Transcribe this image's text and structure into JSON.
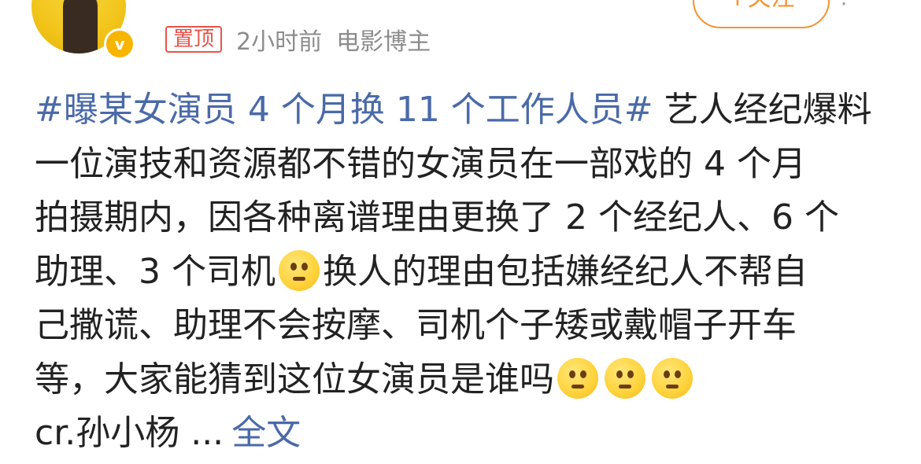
{
  "post": {
    "author_name": "",
    "follow_label": "+关注",
    "more_label": "⋮",
    "pin_label": "置顶",
    "time": "2小时前",
    "source": "电影博主",
    "topic": "#曝某女演员 4 个月换 11 个工作人员#",
    "text_lines": [
      " 艺人经纪爆料",
      "一位演技和资源都不错的女演员在一部戏的 4 个月",
      "拍摄期内，因各种离谱理由更换了 2 个经纪人、6 个",
      "助理、3 个司机",
      "换人的理由包括嫌经纪人不帮自",
      "己撒谎、助理不会按摩、司机个子矮或戴帽子开车",
      "等，大家能猜到这位女演员是谁吗",
      "cr.孙小杨 ..."
    ],
    "full_text_link": "全文",
    "emojis": [
      "thinking-face-icon",
      "thinking-face-icon",
      "thinking-face-icon",
      "thinking-face-icon"
    ]
  },
  "colors": {
    "accent_orange": "#f7922d",
    "topic_blue": "#4a6aa8",
    "pin_red": "#e8524a",
    "meta_gray": "#8c8c8c"
  }
}
